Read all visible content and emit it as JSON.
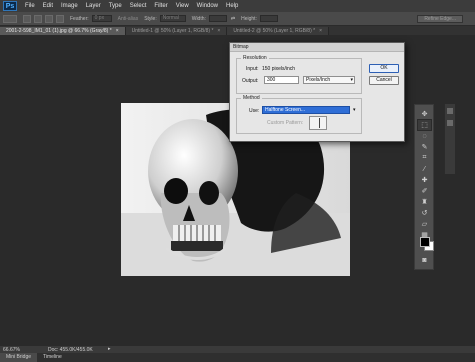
{
  "app": {
    "logo": "Ps"
  },
  "menu": [
    "File",
    "Edit",
    "Image",
    "Layer",
    "Type",
    "Select",
    "Filter",
    "View",
    "Window",
    "Help"
  ],
  "options_bar": {
    "feather_label": "Feather:",
    "feather_value": "0 px",
    "anti_alias_label": "Anti-alias",
    "style_label": "Style:",
    "style_value": "Normal",
    "width_label": "Width:",
    "height_label": "Height:",
    "refine_edge_label": "Refine Edge..."
  },
  "tabs": [
    {
      "label": "2001-2-598_IM1_01 (1).jpg @ 66.7% (Gray/8) *",
      "close": "×",
      "active": true
    },
    {
      "label": "Untitled-1 @ 50% (Layer 1, RGB/8) *",
      "close": "×",
      "active": false
    },
    {
      "label": "Untitled-2 @ 50% (Layer 1, RGB/8) *",
      "close": "×",
      "active": false
    }
  ],
  "dialog": {
    "title": "Bitmap",
    "resolution_group_label": "Resolution",
    "input_label": "Input:",
    "input_value": "150 pixels/inch",
    "output_label": "Output:",
    "output_value": "300",
    "output_unit": "Pixels/Inch",
    "method_group_label": "Method",
    "use_label": "Use:",
    "use_value": "Halftone Screen...",
    "custom_pattern_label": "Custom Pattern:",
    "ok_label": "OK",
    "cancel_label": "Cancel"
  },
  "status": {
    "zoom": "66.67%",
    "doc": "Doc: 455.0K/455.0K"
  },
  "bottom_tabs": [
    "Mini Bridge",
    "Timeline"
  ],
  "colors": {
    "accent": "#2f6ed6",
    "chrome": "#3c3c3c",
    "workspace": "#2a2a2a"
  },
  "tools_icons": [
    "move-icon",
    "marquee-icon",
    "lasso-icon",
    "quick-select-icon",
    "crop-icon",
    "eyedropper-icon",
    "healing-icon",
    "brush-icon",
    "stamp-icon",
    "history-brush-icon",
    "eraser-icon",
    "gradient-icon",
    "blur-icon",
    "dodge-icon",
    "pen-icon",
    "type-icon",
    "path-select-icon",
    "shape-icon",
    "hand-icon",
    "zoom-icon"
  ]
}
